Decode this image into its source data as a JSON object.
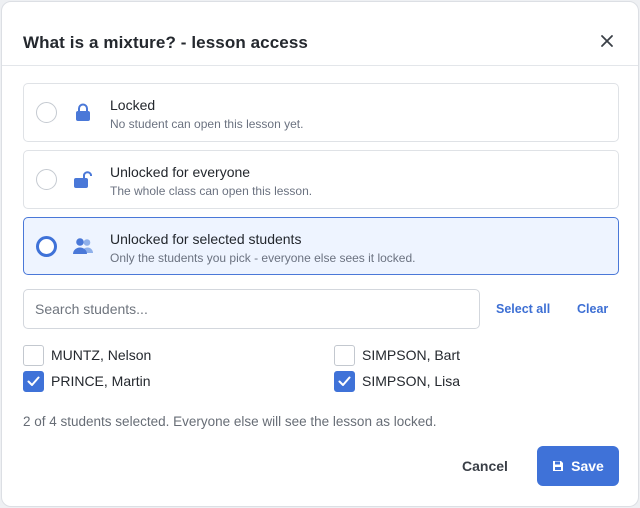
{
  "dialog": {
    "title": "What is a mixture? - lesson access",
    "close_icon": "close-icon"
  },
  "options": [
    {
      "label": "Locked",
      "description": "No student can open this lesson yet.",
      "icon": "lock-icon",
      "selected": false
    },
    {
      "label": "Unlocked for everyone",
      "description": "The whole class can open this lesson.",
      "icon": "unlock-icon",
      "selected": false
    },
    {
      "label": "Unlocked for selected students",
      "description": "Only the students you pick - everyone else sees it locked.",
      "icon": "users-icon",
      "selected": true
    }
  ],
  "search": {
    "placeholder": "Search students...",
    "value": ""
  },
  "actions": {
    "select_all": "Select all",
    "clear": "Clear"
  },
  "students": [
    {
      "name": "MUNTZ, Nelson",
      "checked": false
    },
    {
      "name": "PRINCE, Martin",
      "checked": true
    },
    {
      "name": "SIMPSON, Bart",
      "checked": false
    },
    {
      "name": "SIMPSON, Lisa",
      "checked": true
    }
  ],
  "summary": "2 of 4 students selected. Everyone else will see the lesson as locked.",
  "footer": {
    "cancel_label": "Cancel",
    "save_label": "Save",
    "save_icon": "save-icon"
  },
  "colors": {
    "accent": "#3f72d8",
    "selected_bg": "#eef4ff",
    "icon_blue": "#4a78d8"
  }
}
